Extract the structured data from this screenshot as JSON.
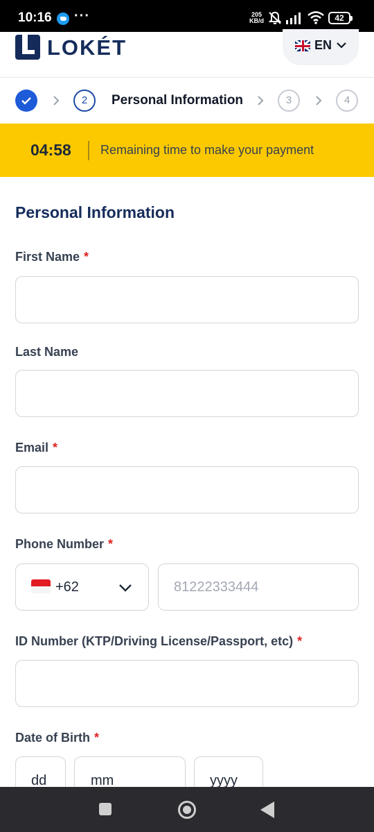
{
  "status_bar": {
    "time": "10:16",
    "more": "···",
    "speed_value": "205",
    "speed_unit": "KB/d",
    "battery": "42"
  },
  "header": {
    "logo_text": "LOKÉT",
    "language": "EN"
  },
  "stepper": {
    "steps": [
      {
        "number": "",
        "state": "done"
      },
      {
        "number": "2",
        "state": "active"
      },
      {
        "number": "3",
        "state": "pending"
      },
      {
        "number": "4",
        "state": "pending"
      }
    ],
    "active_title": "Personal Information"
  },
  "timer": {
    "value": "04:58",
    "label": "Remaining time to make your payment"
  },
  "form": {
    "section_title": "Personal Information",
    "required_mark": "*",
    "first_name": {
      "label": "First Name",
      "value": ""
    },
    "last_name": {
      "label": "Last Name",
      "value": ""
    },
    "email": {
      "label": "Email",
      "value": ""
    },
    "phone": {
      "label": "Phone Number",
      "country_code": "+62",
      "placeholder": "81222333444"
    },
    "id_number": {
      "label": "ID Number (KTP/Driving License/Passport, etc)",
      "value": ""
    },
    "dob": {
      "label": "Date of Birth",
      "day": "dd",
      "month": "mm",
      "year": "yyyy"
    }
  },
  "colors": {
    "brand_navy": "#152c5b",
    "accent_blue": "#1e5bd8",
    "timer_yellow": "#fcc900",
    "required_red": "#e02424"
  }
}
